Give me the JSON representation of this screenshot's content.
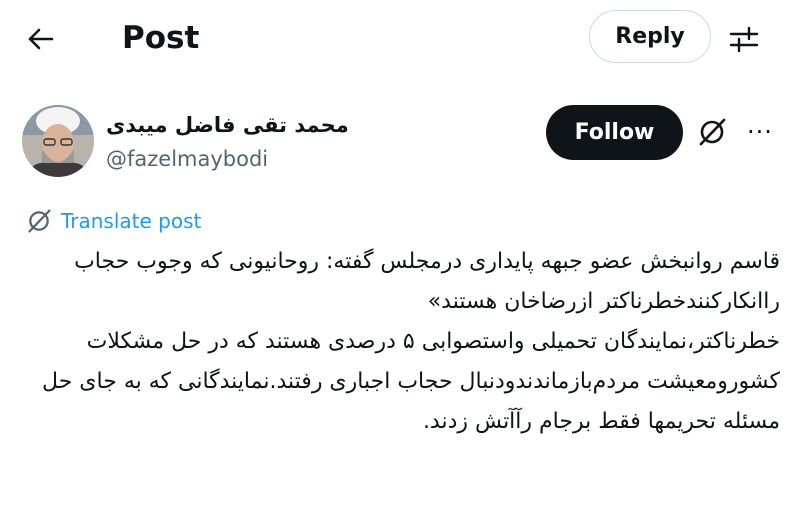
{
  "header": {
    "back_icon": "arrow-left-icon",
    "title": "Post",
    "reply_label": "Reply",
    "filter_icon": "sliders-icon"
  },
  "author": {
    "display_name": "محمد تقی فاضل میبدی",
    "handle": "@fazelmaybodi",
    "follow_label": "Follow",
    "grok_icon": "grok-icon",
    "more_icon": "more-icon",
    "more_label": "···"
  },
  "translate": {
    "icon": "translate-icon",
    "label": "Translate post"
  },
  "post": {
    "text": "قاسم روانبخش عضو جبهه پایداری درمجلس گفته: روحانیونی که وجوب حجاب راانکارکنندخطرناکتر ازرضاخان هستند»\nخطرناکتر،نمایندگان تحمیلی واستصوابی ۵ درصدی هستند که در حل مشکلات کشورومعیشت مردم‌بازماندندودنبال حجاب اجباری رفتند.نمایندگانی که به جای حل مسئله تحریمها فقط برجام رآآتش زدند."
  },
  "colors": {
    "text": "#0f1419",
    "secondary": "#536471",
    "link": "#1d9bf0",
    "border": "#cfd9de",
    "button_dark": "#0f1419"
  }
}
